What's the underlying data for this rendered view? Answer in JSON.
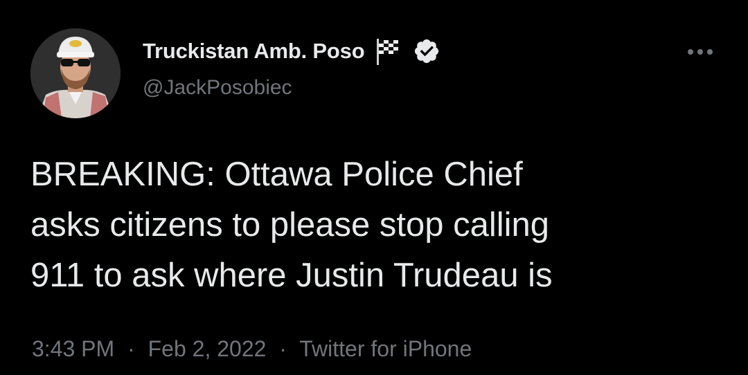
{
  "author": {
    "display_name": "Truckistan Amb. Poso",
    "handle": "@JackPosobiec",
    "name_emoji_icon": "checkered-flag-icon",
    "verified_icon": "verified-badge-icon"
  },
  "tweet": {
    "text_lines": [
      "BREAKING: Ottawa Police Chief",
      "asks citizens to please stop calling",
      "911 to ask where Justin Trudeau is"
    ]
  },
  "meta": {
    "time": "3:43 PM",
    "date": "Feb 2, 2022",
    "source": "Twitter for iPhone",
    "separator": "·"
  },
  "colors": {
    "background": "#000000",
    "primary_text": "#e7e9ea",
    "secondary_text": "#71767b"
  }
}
